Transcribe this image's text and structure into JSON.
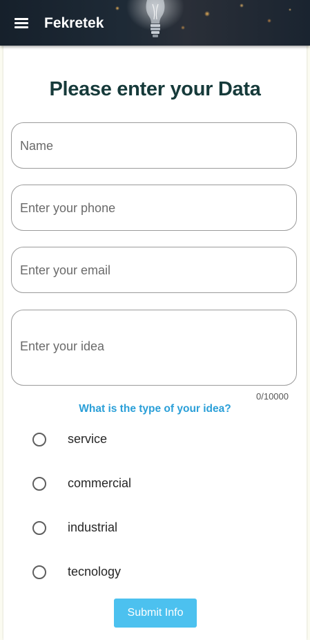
{
  "app": {
    "title": "Fekretek"
  },
  "form": {
    "heading": "Please enter your Data",
    "name_placeholder": "Name",
    "phone_placeholder": "Enter your phone",
    "email_placeholder": "Enter your email",
    "idea_placeholder": "Enter your idea",
    "idea_counter": "0/10000",
    "type_question": "What is the type of your idea?",
    "idea_types": [
      "service",
      "commercial",
      "industrial",
      "tecnology"
    ],
    "submit_label": "Submit Info"
  },
  "icons": {
    "menu": "menu-icon",
    "header_image": "light-bulb-icon",
    "radio": "radio-unchecked-icon"
  },
  "colors": {
    "heading": "#163a3a",
    "question": "#2a9fd8",
    "submit_button": "#4cc1ef",
    "field_border": "#9a9a9a"
  }
}
